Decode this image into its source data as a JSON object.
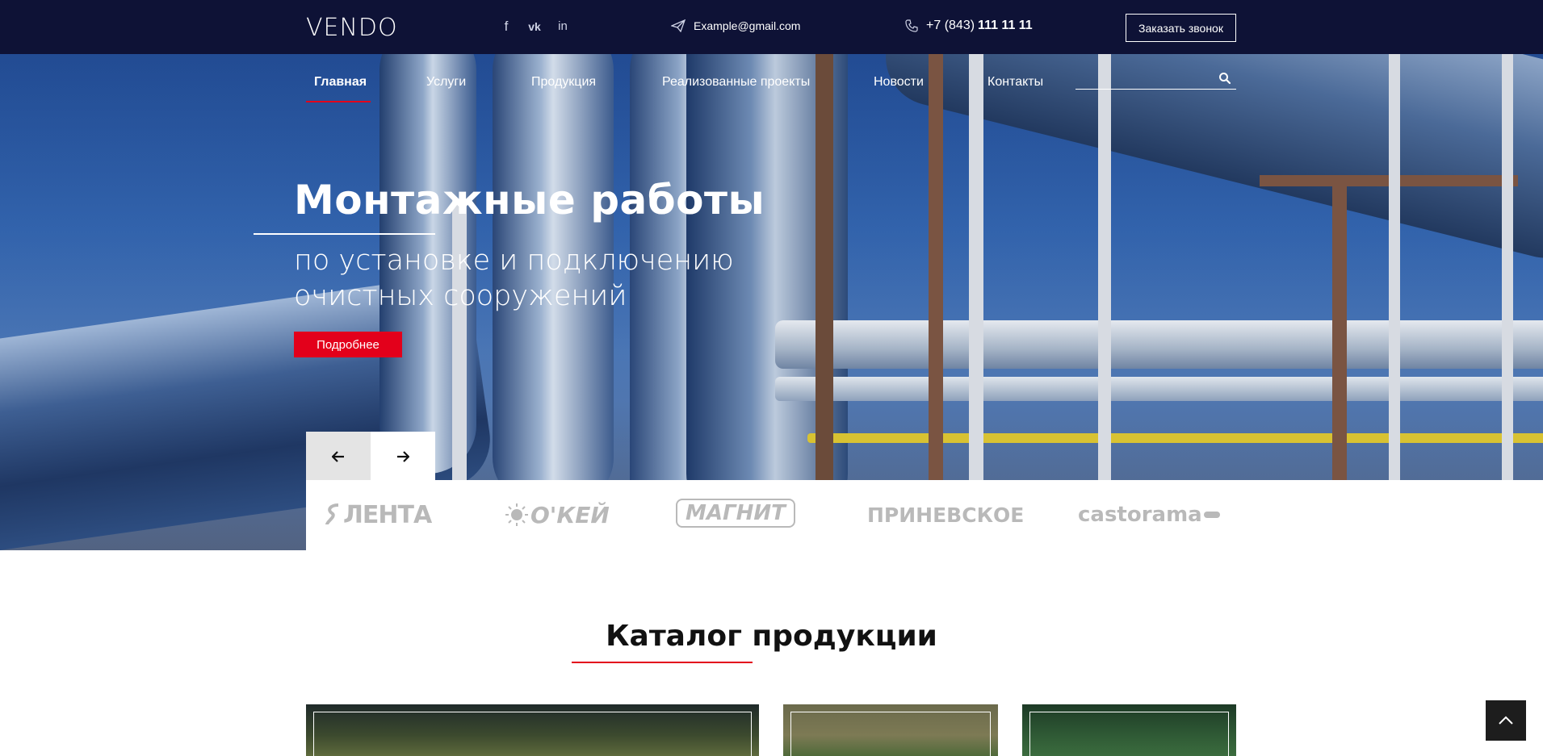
{
  "header": {
    "logo": "VENDO",
    "socials": [
      {
        "icon": "facebook-icon",
        "glyph": "f"
      },
      {
        "icon": "vk-icon",
        "glyph": "vk"
      },
      {
        "icon": "linkedin-icon",
        "glyph": "in"
      }
    ],
    "email": "Example@gmail.com",
    "phone_prefix": "+7 (843)",
    "phone_number": "111 11 11",
    "call_button": "Заказать звонок"
  },
  "nav": {
    "items": [
      "Главная",
      "Услуги",
      "Продукция",
      "Реализованные проекты",
      "Новости",
      "Контакты"
    ],
    "active_index": 0,
    "search_placeholder": ""
  },
  "hero": {
    "title": "Монтажные работы",
    "subtitle": "по установке и подключению очистных сооружений",
    "button": "Подробнее"
  },
  "partners": [
    "ЛЕНТА",
    "О'КЕЙ",
    "МАГНИТ",
    "ПРИНЕВСКОЕ",
    "castorama"
  ],
  "catalog": {
    "title": "Каталог продукции"
  },
  "colors": {
    "topbar_bg": "#0e1236",
    "accent_red": "#e3001b",
    "partner_grey": "#b9b9b9"
  }
}
